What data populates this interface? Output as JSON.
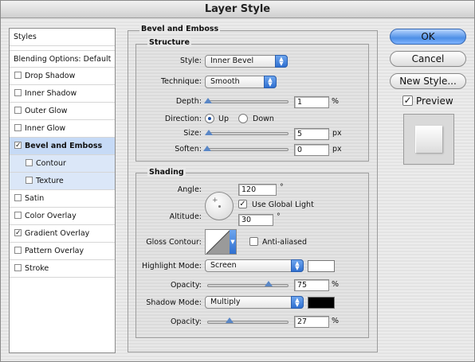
{
  "window": {
    "title": "Layer Style"
  },
  "styles_list": {
    "header": "Styles",
    "blending": "Blending Options: Default",
    "items": [
      {
        "label": "Drop Shadow",
        "checked": false
      },
      {
        "label": "Inner Shadow",
        "checked": false
      },
      {
        "label": "Outer Glow",
        "checked": false
      },
      {
        "label": "Inner Glow",
        "checked": false
      },
      {
        "label": "Bevel and Emboss",
        "checked": true,
        "selected": true
      },
      {
        "label": "Contour",
        "checked": false,
        "sub": true
      },
      {
        "label": "Texture",
        "checked": false,
        "sub": true
      },
      {
        "label": "Satin",
        "checked": false
      },
      {
        "label": "Color Overlay",
        "checked": false
      },
      {
        "label": "Gradient Overlay",
        "checked": true
      },
      {
        "label": "Pattern Overlay",
        "checked": false
      },
      {
        "label": "Stroke",
        "checked": false
      }
    ]
  },
  "panel": {
    "title": "Bevel and Emboss",
    "structure": {
      "title": "Structure",
      "style_label": "Style:",
      "style_value": "Inner Bevel",
      "technique_label": "Technique:",
      "technique_value": "Smooth",
      "depth_label": "Depth:",
      "depth_value": "1",
      "depth_unit": "%",
      "direction_label": "Direction:",
      "direction_up": "Up",
      "direction_down": "Down",
      "size_label": "Size:",
      "size_value": "5",
      "size_unit": "px",
      "soften_label": "Soften:",
      "soften_value": "0",
      "soften_unit": "px"
    },
    "shading": {
      "title": "Shading",
      "angle_label": "Angle:",
      "angle_value": "120",
      "degree_symbol": "°",
      "use_global_light": "Use Global Light",
      "altitude_label": "Altitude:",
      "altitude_value": "30",
      "gloss_contour_label": "Gloss Contour:",
      "anti_aliased": "Anti-aliased",
      "highlight_mode_label": "Highlight Mode:",
      "highlight_mode_value": "Screen",
      "highlight_opacity_label": "Opacity:",
      "highlight_opacity_value": "75",
      "shadow_mode_label": "Shadow Mode:",
      "shadow_mode_value": "Multiply",
      "shadow_opacity_label": "Opacity:",
      "shadow_opacity_value": "27",
      "percent": "%",
      "highlight_color": "#ffffff",
      "shadow_color": "#000000"
    }
  },
  "buttons": {
    "ok": "OK",
    "cancel": "Cancel",
    "new_style": "New Style...",
    "preview": "Preview"
  },
  "sliders": {
    "depth_fraction": 0.01,
    "size_fraction": 0.02,
    "soften_fraction": 0.0,
    "highlight_opacity_fraction": 0.75,
    "shadow_opacity_fraction": 0.27
  },
  "icons": [
    "checkmark-icon",
    "popup-arrows-icon",
    "angle-dial-icon",
    "contour-curve-icon",
    "preview-swatch-icon"
  ]
}
